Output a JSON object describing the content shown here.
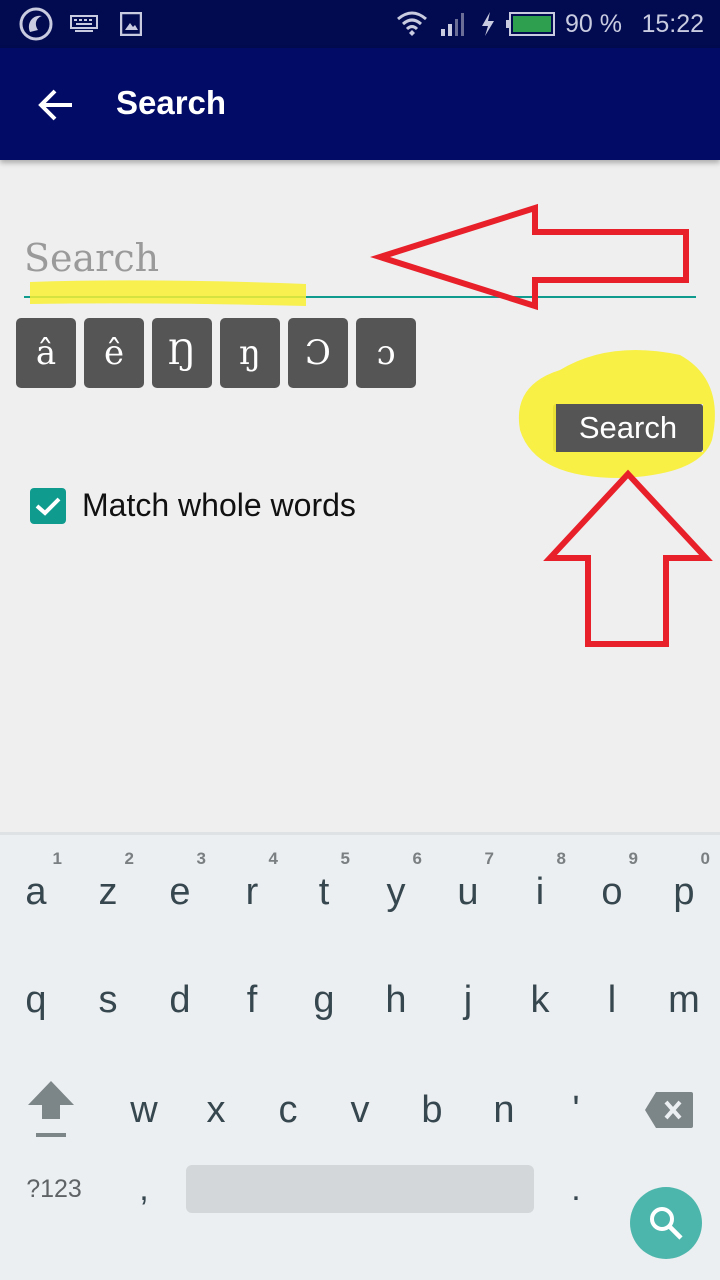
{
  "status_bar": {
    "left_icons": [
      "app-logo-icon",
      "keyboard-icon",
      "image-icon"
    ],
    "right_icons": [
      "wifi-icon",
      "signal-icon",
      "charging-icon",
      "battery-icon"
    ],
    "battery_percent": "90 %",
    "battery_level": 0.9,
    "time": "15:22",
    "battery_color": "#2e9e4f"
  },
  "app_bar": {
    "title": "Search",
    "back_icon": "arrow-left-icon",
    "background": "#020b66"
  },
  "search": {
    "placeholder": "Search",
    "value": "",
    "accent": "#0f9b8e"
  },
  "special_chars": [
    "â",
    "ê",
    "Ŋ",
    "ŋ",
    "Ɔ",
    "ɔ"
  ],
  "search_button": {
    "label": "Search"
  },
  "match_whole_words": {
    "label": "Match whole words",
    "checked": true
  },
  "keyboard": {
    "row1": [
      {
        "key": "a",
        "hint": "1"
      },
      {
        "key": "z",
        "hint": "2"
      },
      {
        "key": "e",
        "hint": "3"
      },
      {
        "key": "r",
        "hint": "4"
      },
      {
        "key": "t",
        "hint": "5"
      },
      {
        "key": "y",
        "hint": "6"
      },
      {
        "key": "u",
        "hint": "7"
      },
      {
        "key": "i",
        "hint": "8"
      },
      {
        "key": "o",
        "hint": "9"
      },
      {
        "key": "p",
        "hint": "0"
      }
    ],
    "row2": [
      "q",
      "s",
      "d",
      "f",
      "g",
      "h",
      "j",
      "k",
      "l",
      "m"
    ],
    "row3": [
      "w",
      "x",
      "c",
      "v",
      "b",
      "n",
      "'"
    ],
    "symbols_label": "?123",
    "comma": ",",
    "period": ".",
    "shift_icon": "shift-arrow-icon",
    "backspace_icon": "backspace-icon",
    "action_icon": "search-icon",
    "action_color": "#4db6ac"
  },
  "annotations": {
    "arrow_color": "#e8202a",
    "highlight_color": "#f8f032"
  }
}
